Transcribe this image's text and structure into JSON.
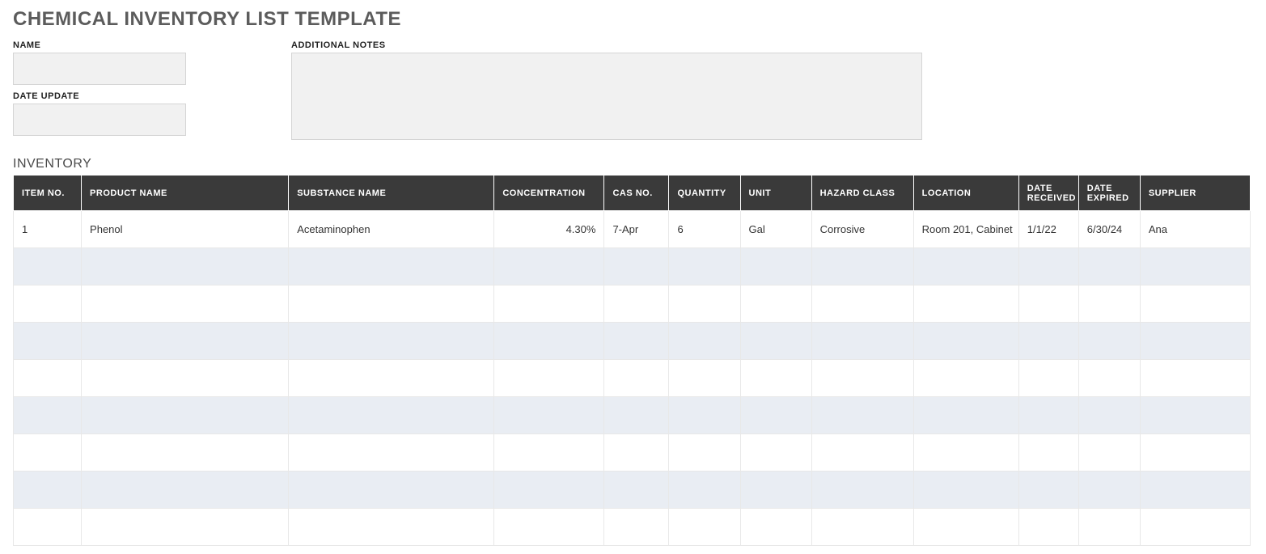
{
  "title": "CHEMICAL INVENTORY LIST TEMPLATE",
  "labels": {
    "name": "NAME",
    "date_update": "DATE UPDATE",
    "additional_notes": "ADDITIONAL NOTES",
    "inventory": "INVENTORY"
  },
  "fields": {
    "name": "",
    "date_update": "",
    "additional_notes": ""
  },
  "columns": {
    "item_no": "ITEM NO.",
    "product_name": "PRODUCT NAME",
    "substance_name": "SUBSTANCE NAME",
    "concentration": "CONCENTRATION",
    "cas_no": "CAS NO.",
    "quantity": "QUANTITY",
    "unit": "UNIT",
    "hazard_class": "HAZARD CLASS",
    "location": "LOCATION",
    "date_received": "DATE RECEIVED",
    "date_expired": "DATE EXPIRED",
    "supplier": "SUPPLIER"
  },
  "rows": [
    {
      "item_no": "1",
      "product_name": "Phenol",
      "substance_name": "Acetaminophen",
      "concentration": "4.30%",
      "cas_no": "7-Apr",
      "quantity": "6",
      "unit": "Gal",
      "hazard_class": "Corrosive",
      "location": "Room 201, Cabinet",
      "date_received": "1/1/22",
      "date_expired": "6/30/24",
      "supplier": "Ana"
    },
    {
      "item_no": "",
      "product_name": "",
      "substance_name": "",
      "concentration": "",
      "cas_no": "",
      "quantity": "",
      "unit": "",
      "hazard_class": "",
      "location": "",
      "date_received": "",
      "date_expired": "",
      "supplier": ""
    },
    {
      "item_no": "",
      "product_name": "",
      "substance_name": "",
      "concentration": "",
      "cas_no": "",
      "quantity": "",
      "unit": "",
      "hazard_class": "",
      "location": "",
      "date_received": "",
      "date_expired": "",
      "supplier": ""
    },
    {
      "item_no": "",
      "product_name": "",
      "substance_name": "",
      "concentration": "",
      "cas_no": "",
      "quantity": "",
      "unit": "",
      "hazard_class": "",
      "location": "",
      "date_received": "",
      "date_expired": "",
      "supplier": ""
    },
    {
      "item_no": "",
      "product_name": "",
      "substance_name": "",
      "concentration": "",
      "cas_no": "",
      "quantity": "",
      "unit": "",
      "hazard_class": "",
      "location": "",
      "date_received": "",
      "date_expired": "",
      "supplier": ""
    },
    {
      "item_no": "",
      "product_name": "",
      "substance_name": "",
      "concentration": "",
      "cas_no": "",
      "quantity": "",
      "unit": "",
      "hazard_class": "",
      "location": "",
      "date_received": "",
      "date_expired": "",
      "supplier": ""
    },
    {
      "item_no": "",
      "product_name": "",
      "substance_name": "",
      "concentration": "",
      "cas_no": "",
      "quantity": "",
      "unit": "",
      "hazard_class": "",
      "location": "",
      "date_received": "",
      "date_expired": "",
      "supplier": ""
    },
    {
      "item_no": "",
      "product_name": "",
      "substance_name": "",
      "concentration": "",
      "cas_no": "",
      "quantity": "",
      "unit": "",
      "hazard_class": "",
      "location": "",
      "date_received": "",
      "date_expired": "",
      "supplier": ""
    },
    {
      "item_no": "",
      "product_name": "",
      "substance_name": "",
      "concentration": "",
      "cas_no": "",
      "quantity": "",
      "unit": "",
      "hazard_class": "",
      "location": "",
      "date_received": "",
      "date_expired": "",
      "supplier": ""
    }
  ]
}
